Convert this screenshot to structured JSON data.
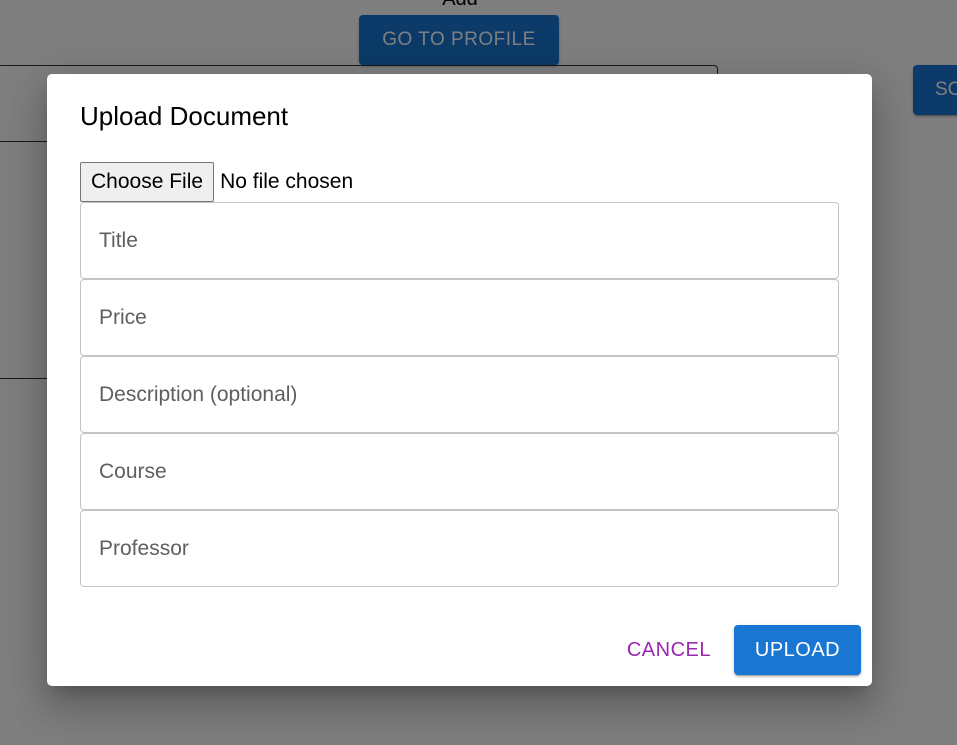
{
  "background": {
    "add_label": "Add",
    "profile_button_label": "GO TO PROFILE",
    "right_button_label": "SC"
  },
  "dialog": {
    "title": "Upload Document",
    "file_input": {
      "button_label": "Choose File",
      "status_text": "No file chosen"
    },
    "fields": {
      "title": {
        "placeholder": "Title",
        "value": ""
      },
      "price": {
        "placeholder": "Price",
        "value": ""
      },
      "description": {
        "placeholder": "Description (optional)",
        "value": ""
      },
      "course": {
        "placeholder": "Course",
        "value": ""
      },
      "professor": {
        "placeholder": "Professor",
        "value": ""
      }
    },
    "actions": {
      "cancel_label": "CANCEL",
      "upload_label": "UPLOAD"
    }
  },
  "colors": {
    "primary": "#1976d2",
    "secondary": "#9c27b0",
    "backdrop": "rgba(0,0,0,0.5)"
  }
}
